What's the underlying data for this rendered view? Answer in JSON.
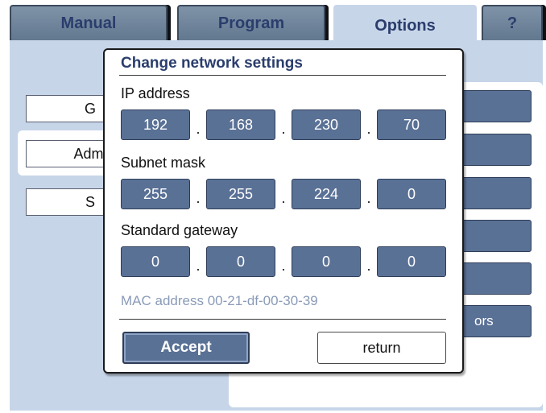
{
  "tabs": {
    "manual": "Manual",
    "program": "Program",
    "options": "Options",
    "help": "?"
  },
  "background": {
    "left_buttons": [
      "G",
      "Admi",
      "S"
    ],
    "right_buttons": [
      "",
      "",
      "",
      "",
      "",
      "ors"
    ]
  },
  "dialog": {
    "title": "Change network settings",
    "ip_label": "IP address",
    "ip": [
      "192",
      "168",
      "230",
      "70"
    ],
    "subnet_label": "Subnet mask",
    "subnet": [
      "255",
      "255",
      "224",
      "0"
    ],
    "gateway_label": "Standard gateway",
    "gateway": [
      "0",
      "0",
      "0",
      "0"
    ],
    "separator": ".",
    "mac": "MAC address 00-21-df-00-30-39",
    "accept_label": "Accept",
    "return_label": "return"
  },
  "colors": {
    "accent": "#5a7196",
    "title": "#2a3d6c",
    "panel": "#c7d5e9",
    "mac_text": "#8a9bb8"
  }
}
